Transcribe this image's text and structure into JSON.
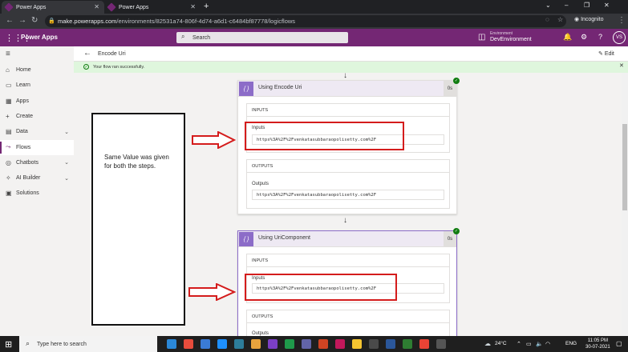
{
  "browser": {
    "tabs": [
      {
        "label": "Power Apps",
        "active": true
      },
      {
        "label": "Power Apps",
        "active": false
      }
    ],
    "new_tab": "+",
    "url_host": "make.powerapps.com",
    "url_path": "/environments/82531a74-806f-4d74-a6d1-c6484bf87778/logicflows",
    "profile": "Incognito",
    "window_controls": [
      "⌄",
      "–",
      "❐",
      "✕"
    ]
  },
  "app_header": {
    "title": "Power Apps",
    "search_placeholder": "Search",
    "environment_label": "Environment",
    "environment_name": "DevEnvironment",
    "avatar_initials": "VS"
  },
  "sidebar": {
    "items": [
      {
        "label": "Home",
        "icon": "home-icon",
        "glyph": "⌂",
        "chevron": false,
        "active": false
      },
      {
        "label": "Learn",
        "icon": "book-icon",
        "glyph": "▭",
        "chevron": false,
        "active": false
      },
      {
        "label": "Apps",
        "icon": "apps-icon",
        "glyph": "▦",
        "chevron": false,
        "active": false
      },
      {
        "label": "Create",
        "icon": "plus-icon",
        "glyph": "+",
        "chevron": false,
        "active": false
      },
      {
        "label": "Data",
        "icon": "database-icon",
        "glyph": "▤",
        "chevron": true,
        "active": false
      },
      {
        "label": "Flows",
        "icon": "flow-icon",
        "glyph": "⤳",
        "chevron": false,
        "active": true
      },
      {
        "label": "Chatbots",
        "icon": "chatbot-icon",
        "glyph": "◎",
        "chevron": true,
        "active": false
      },
      {
        "label": "AI Builder",
        "icon": "ai-builder-icon",
        "glyph": "✧",
        "chevron": true,
        "active": false
      },
      {
        "label": "Solutions",
        "icon": "solutions-icon",
        "glyph": "▣",
        "chevron": false,
        "active": false
      }
    ]
  },
  "flow": {
    "title": "Encode Uri",
    "edit_label": "Edit",
    "success_message": "Your flow ran successfully.",
    "cards": [
      {
        "title": "Using Encode Uri",
        "duration": "0s",
        "inputs_header": "INPUTS",
        "inputs_label": "Inputs",
        "inputs_value": "https%3A%2F%2Fvenkatasubbaraopolisetty.com%2F",
        "outputs_header": "OUTPUTS",
        "outputs_label": "Outputs",
        "outputs_value": "https%3A%2F%2Fvenkatasubbaraopolisetty.com%2F"
      },
      {
        "title": "Using UriComponent",
        "duration": "0s",
        "inputs_header": "INPUTS",
        "inputs_label": "Inputs",
        "inputs_value": "https%3A%2F%2Fvenkatasubbaraopolisetty.com%2F",
        "outputs_header": "OUTPUTS",
        "outputs_label": "Outputs"
      }
    ]
  },
  "annotation": {
    "text": "Same Value was given for both the steps."
  },
  "taskbar": {
    "search_placeholder": "Type here to search",
    "weather": "24°C",
    "language": "ENG",
    "time": "11:05 PM",
    "date": "30-07-2021",
    "icon_colors": [
      "#2b88d8",
      "#e74c3c",
      "#3a7bd5",
      "#1e90ff",
      "#2d7d9a",
      "#e8a33d",
      "#7b3fc5",
      "#1f9a4b",
      "#6264a7",
      "#d04423",
      "#c2185b",
      "#f4c430",
      "#4a4a4a",
      "#2b579a",
      "#2e7d32",
      "#ea4335",
      "#555555"
    ]
  },
  "colors": {
    "brand": "#742774",
    "success_bg": "#dff6dd",
    "annotation_red": "#d41c1c"
  }
}
